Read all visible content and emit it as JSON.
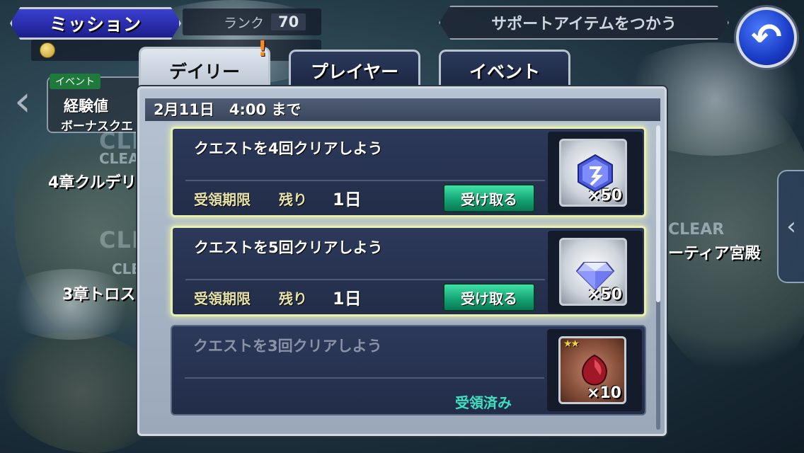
{
  "header": {
    "title": "ミッション",
    "rank_label": "ランク",
    "rank_value": "70",
    "support_button": "サポートアイテムをつかう"
  },
  "background": {
    "event_tag": "イベント",
    "event_line1": "経験値",
    "event_line2": "ボーナスクエ",
    "clear_texts": [
      "CLEAR",
      "CLEAR",
      "CLEAR",
      "CLEAR",
      "CLEAR"
    ],
    "chapter4": "4章クルデリ",
    "chapter3": "3章トロス",
    "right_place": "ーティア宮殿"
  },
  "tabs": [
    {
      "label": "デイリー",
      "active": true
    },
    {
      "label": "プレイヤー",
      "active": false
    },
    {
      "label": "イベント",
      "active": false
    }
  ],
  "panel": {
    "deadline": "2月11日　4:00 まで"
  },
  "missions": [
    {
      "title": "クエストを4回クリアしよう",
      "limit_label": "受領期限",
      "remain_label": "残り",
      "days": "1日",
      "claim_label": "受け取る",
      "quantity": "×50",
      "reward_icon": "crystal-shard-icon"
    },
    {
      "title": "クエストを5回クリアしよう",
      "limit_label": "受領期限",
      "remain_label": "残り",
      "days": "1日",
      "claim_label": "受け取る",
      "quantity": "×50",
      "reward_icon": "diamond-icon"
    },
    {
      "title": "クエストを3回クリアしよう",
      "claimed_label": "受領済み",
      "quantity": "×10",
      "reward_icon": "ruby-icon",
      "rarity": "★★"
    }
  ],
  "colors": {
    "title_plate": "#2a2fb0",
    "claim_button": "#13a070",
    "claimed_text": "#3fe0c0",
    "limit_text": "#e8e4a8"
  }
}
